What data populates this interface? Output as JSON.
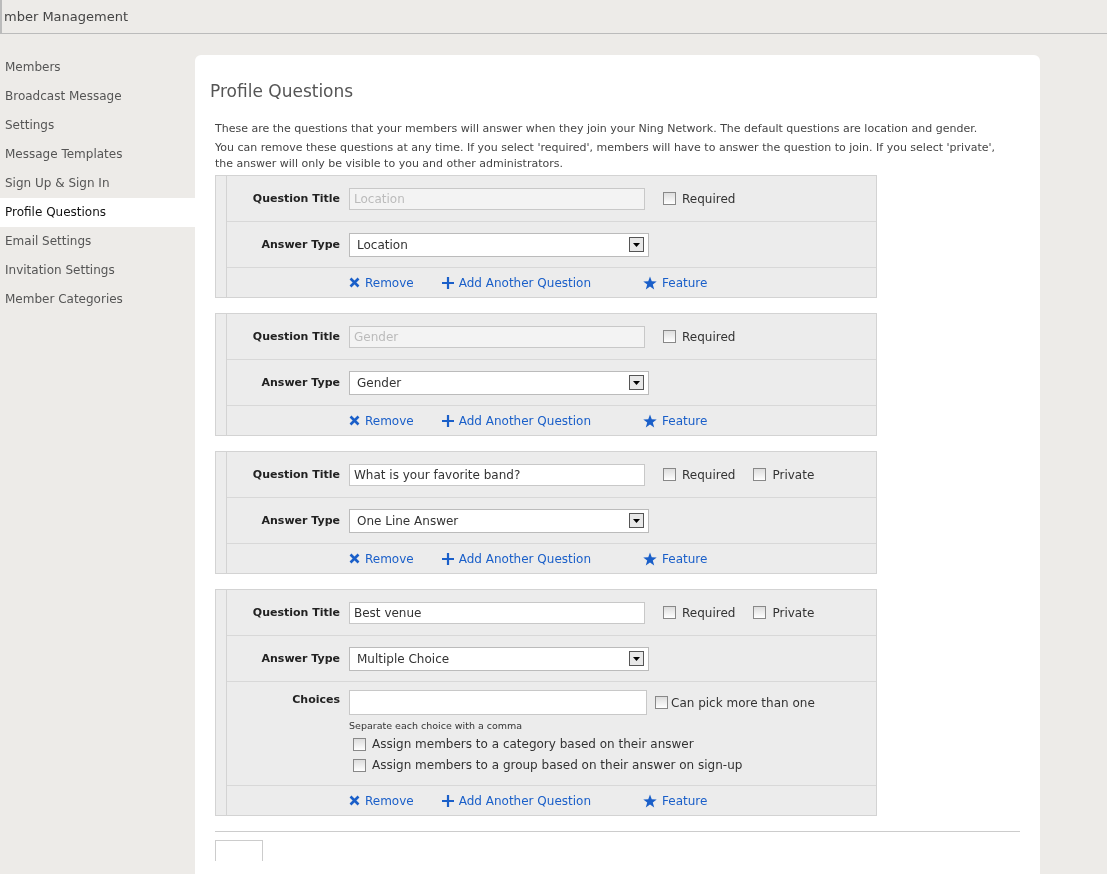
{
  "header": {
    "title": "mber Management"
  },
  "sidebar": {
    "items": [
      {
        "label": "Members",
        "selected": false
      },
      {
        "label": "Broadcast Message",
        "selected": false
      },
      {
        "label": "Settings",
        "selected": false
      },
      {
        "label": "Message Templates",
        "selected": false
      },
      {
        "label": "Sign Up & Sign In",
        "selected": false
      },
      {
        "label": "Profile Questions",
        "selected": true
      },
      {
        "label": "Email Settings",
        "selected": false
      },
      {
        "label": "Invitation Settings",
        "selected": false
      },
      {
        "label": "Member Categories",
        "selected": false
      }
    ]
  },
  "page": {
    "title": "Profile Questions",
    "intro": [
      "These are the questions that your members will answer when they join your Ning Network. The default questions are location and gender.",
      "You can remove these questions at any time. If you select 'required', members will have to answer the question to join. If you select 'private', the answer will only be visible to you and other administrators."
    ]
  },
  "questions": [
    {
      "title_label": "Question Title",
      "title_value": "Location",
      "title_disabled": true,
      "required": {
        "label": "Required",
        "checked": false
      },
      "answer_label": "Answer Type",
      "answer_type": "Location",
      "actions": [
        "Remove",
        "Add Another Question",
        "Feature"
      ]
    },
    {
      "title_label": "Question Title",
      "title_value": "Gender",
      "title_disabled": true,
      "required": {
        "label": "Required",
        "checked": false
      },
      "answer_label": "Answer Type",
      "answer_type": "Gender",
      "actions": [
        "Remove",
        "Add Another Question",
        "Feature"
      ]
    },
    {
      "title_label": "Question Title",
      "title_value": "What is your favorite band?",
      "title_disabled": false,
      "required": {
        "label": "Required",
        "checked": false
      },
      "private": {
        "label": "Private",
        "checked": false
      },
      "answer_label": "Answer Type",
      "answer_type": "One Line Answer",
      "actions": [
        "Remove",
        "Add Another Question",
        "Feature"
      ]
    },
    {
      "title_label": "Question Title",
      "title_value": "Best venue",
      "title_disabled": false,
      "required": {
        "label": "Required",
        "checked": false
      },
      "private": {
        "label": "Private",
        "checked": false
      },
      "answer_label": "Answer Type",
      "answer_type": "Multiple Choice",
      "choices": {
        "label": "Choices",
        "multi": {
          "label": "Can pick more than one",
          "checked": false
        },
        "hint": "Separate each choice with a comma",
        "options": [
          {
            "label": "Assign members to a category based on their answer",
            "checked": false
          },
          {
            "label": "Assign members to a group based on their answer on sign-up",
            "checked": false
          }
        ]
      },
      "actions": [
        "Remove",
        "Add Another Question",
        "Feature"
      ]
    }
  ]
}
